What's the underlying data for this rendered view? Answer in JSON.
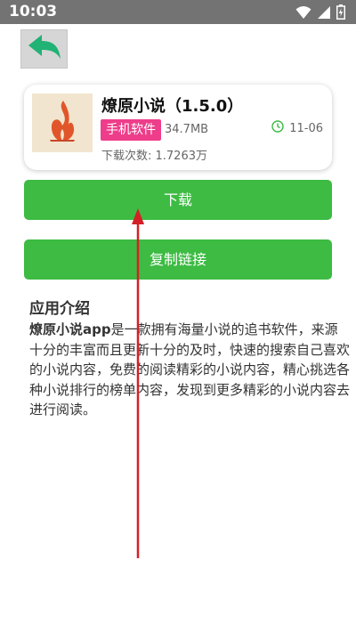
{
  "status_bar": {
    "time": "10:03"
  },
  "icons": {
    "back": "back-arrow-icon",
    "wifi": "wifi-icon",
    "signal": "signal-icon",
    "battery": "battery-icon",
    "app_logo": "flame-logo-icon",
    "clock": "clock-icon"
  },
  "colors": {
    "accent_green": "#3dbb43",
    "badge_pink": "#ee3d8a",
    "annotation_red": "#d32027"
  },
  "app": {
    "name": "燎原小说（1.5.0）",
    "category": "手机软件",
    "size": "34.7MB",
    "date": "11-06",
    "downloads": "下载次数: 1.7263万"
  },
  "buttons": {
    "download": "下载",
    "copy_link": "复制链接"
  },
  "intro": {
    "heading": "应用介绍",
    "lead": "燎原小说app",
    "body": "是一款拥有海量小说的追书软件，来源十分的丰富而且更新十分的及时，快速的搜索自己喜欢的小说内容，免费的阅读精彩的小说内容，精心挑选各种小说排行的榜单内容，发现到更多精彩的小说内容去进行阅读。"
  }
}
